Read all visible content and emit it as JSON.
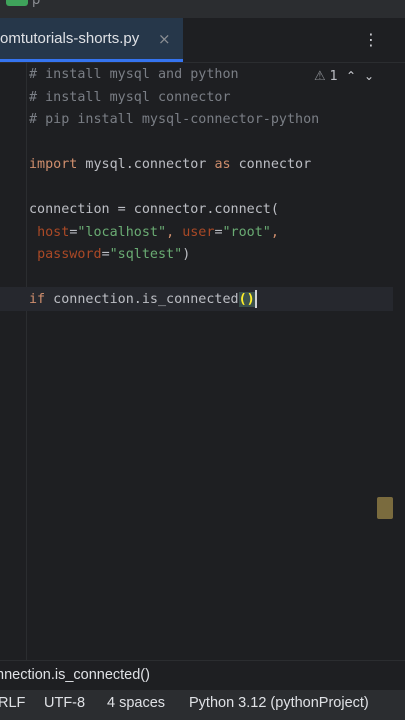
{
  "window": {
    "title": "p"
  },
  "tab": {
    "label": "omtutorials-shorts.py",
    "close": "×"
  },
  "menu": {
    "glyph": "⋮"
  },
  "editor": {
    "lines": [
      {
        "tokens": [
          {
            "t": "# install mysql and python",
            "c": "comment"
          }
        ]
      },
      {
        "tokens": [
          {
            "t": "# install mysql connector",
            "c": "comment"
          }
        ]
      },
      {
        "tokens": [
          {
            "t": "# pip install mysql-connector-python",
            "c": "comment"
          }
        ]
      },
      {
        "tokens": []
      },
      {
        "tokens": [
          {
            "t": "import",
            "c": "kw"
          },
          {
            "t": " mysql.connector ",
            "c": "plain"
          },
          {
            "t": "as",
            "c": "kw"
          },
          {
            "t": " connector",
            "c": "plain"
          }
        ]
      },
      {
        "tokens": []
      },
      {
        "tokens": [
          {
            "t": "connection = connector.connect(",
            "c": "plain"
          }
        ]
      },
      {
        "tokens": [
          {
            "t": " ",
            "c": "plain"
          },
          {
            "t": "host",
            "c": "param"
          },
          {
            "t": "=",
            "c": "plain"
          },
          {
            "t": "\"localhost\"",
            "c": "str"
          },
          {
            "t": ", ",
            "c": "kw"
          },
          {
            "t": "user",
            "c": "param"
          },
          {
            "t": "=",
            "c": "plain"
          },
          {
            "t": "\"root\"",
            "c": "str"
          },
          {
            "t": ",",
            "c": "kw"
          }
        ]
      },
      {
        "tokens": [
          {
            "t": " ",
            "c": "plain"
          },
          {
            "t": "password",
            "c": "param"
          },
          {
            "t": "=",
            "c": "plain"
          },
          {
            "t": "\"sqltest\"",
            "c": "str"
          },
          {
            "t": ")",
            "c": "plain"
          }
        ]
      },
      {
        "tokens": []
      },
      {
        "tokens": [
          {
            "t": "if",
            "c": "kw"
          },
          {
            "t": " connection.is_connected",
            "c": "plain"
          },
          {
            "t": "()",
            "c": "paren-hl"
          }
        ],
        "current": true
      }
    ]
  },
  "inspections": {
    "warning_icon": "⚠",
    "count": "1",
    "up": "⌃",
    "down": "⌄"
  },
  "breadcrumb": {
    "text": "nnection.is_connected()"
  },
  "statusbar": {
    "line_sep": "RLF",
    "encoding": "UTF-8",
    "indent": "4 spaces",
    "interpreter": "Python 3.12 (pythonProject)"
  }
}
